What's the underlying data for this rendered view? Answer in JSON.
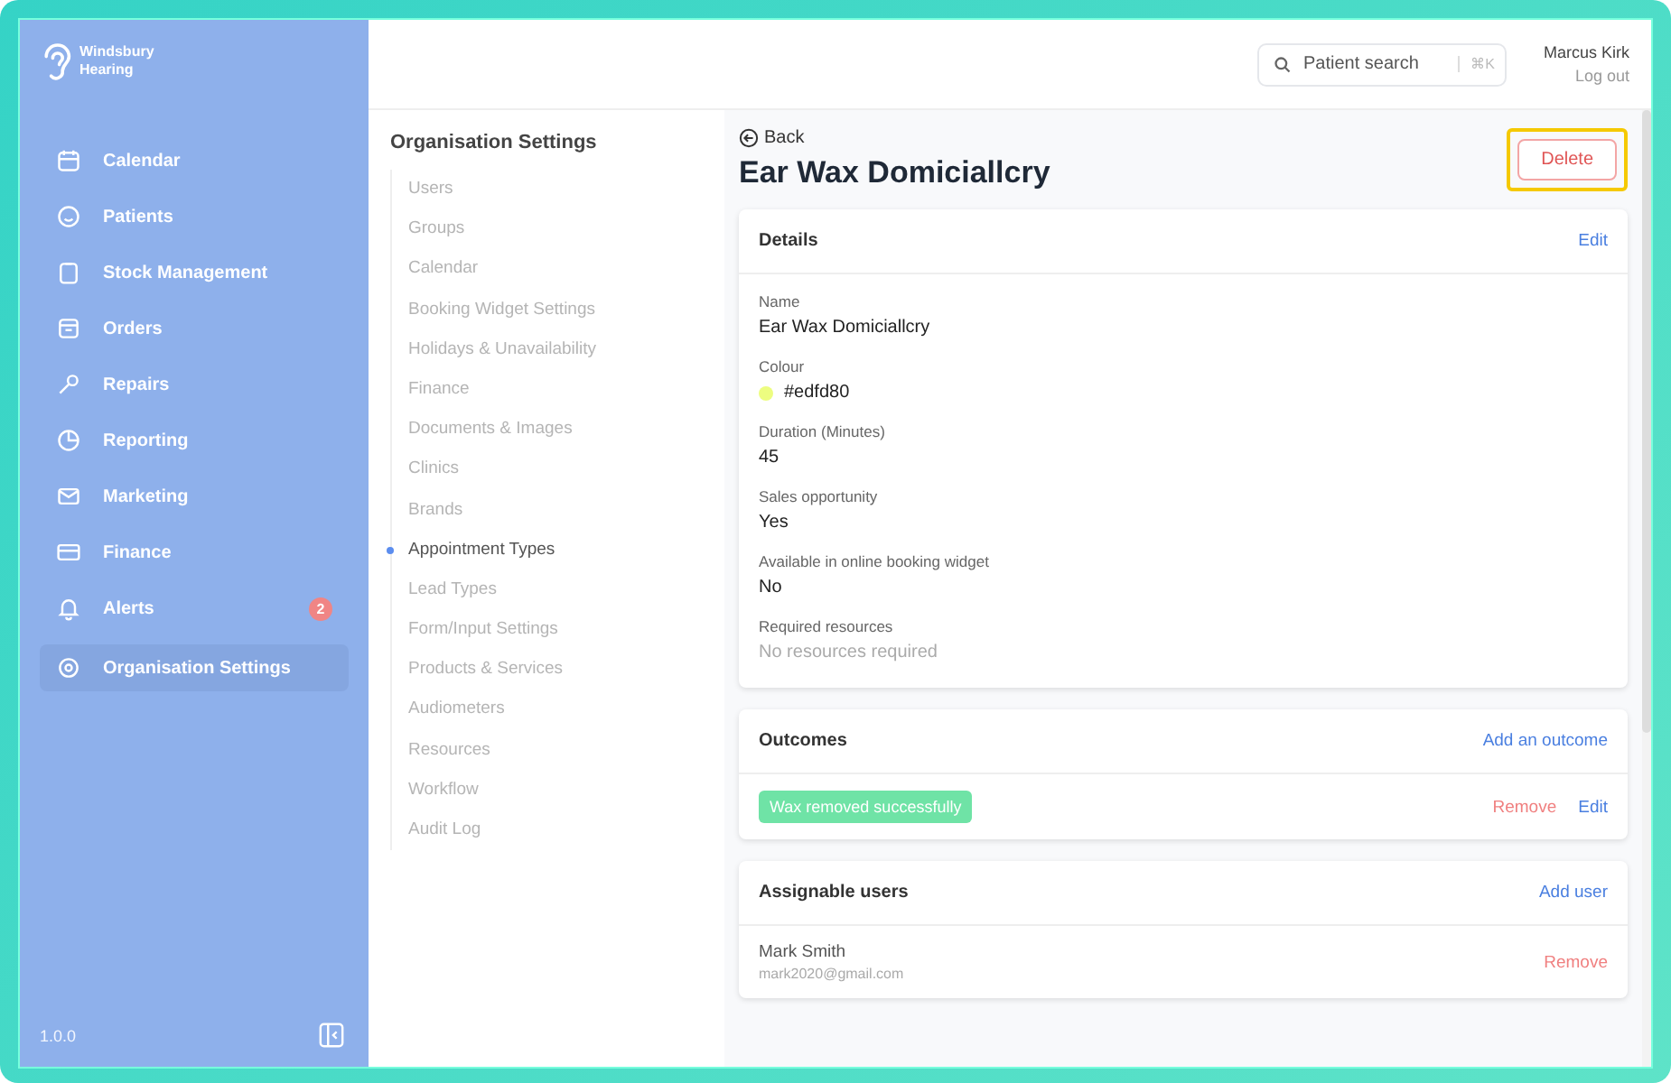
{
  "sidebar": {
    "logo": "Windsbury Hearing",
    "items": [
      {
        "label": "Calendar",
        "selected": false
      },
      {
        "label": "Patients",
        "selected": false
      },
      {
        "label": "Stock Management",
        "selected": false
      },
      {
        "label": "Orders",
        "selected": false
      },
      {
        "label": "Repairs",
        "selected": false
      },
      {
        "label": "Reporting",
        "selected": false
      },
      {
        "label": "Marketing",
        "selected": false
      },
      {
        "label": "Finance",
        "selected": false
      },
      {
        "label": "Alerts",
        "selected": false,
        "badge": "2"
      },
      {
        "label": "Organisation Settings",
        "selected": true
      }
    ],
    "version": "1.0.0"
  },
  "header": {
    "search": {
      "placeholder": "Patient search",
      "shortcut": "⌘K"
    },
    "user_name": "Marcus Kirk",
    "logout": "Log out"
  },
  "settings_nav": {
    "title": "Organisation Settings",
    "items": [
      {
        "label": "Users",
        "selected": false
      },
      {
        "label": "Groups",
        "selected": false
      },
      {
        "label": "Calendar",
        "selected": false
      },
      {
        "label": "Booking Widget Settings",
        "selected": false
      },
      {
        "label": "Holidays & Unavailability",
        "selected": false
      },
      {
        "label": "Finance",
        "selected": false
      },
      {
        "label": "Documents & Images",
        "selected": false
      },
      {
        "label": "Clinics",
        "selected": false
      },
      {
        "label": "Brands",
        "selected": false
      },
      {
        "label": "Appointment Types",
        "selected": true
      },
      {
        "label": "Lead Types",
        "selected": false
      },
      {
        "label": "Form/Input Settings",
        "selected": false
      },
      {
        "label": "Products & Services",
        "selected": false
      },
      {
        "label": "Audiometers",
        "selected": false
      },
      {
        "label": "Resources",
        "selected": false
      },
      {
        "label": "Workflow",
        "selected": false
      },
      {
        "label": "Audit Log",
        "selected": false
      }
    ]
  },
  "page": {
    "back": "Back",
    "title": "Ear Wax Domiciallcry",
    "delete_button": {
      "label": "Delete",
      "highlighted": true
    },
    "details": {
      "title": "Details",
      "edit": "Edit",
      "fields": [
        {
          "label": "Name",
          "value": "Ear Wax Domiciallcry",
          "kind": "text"
        },
        {
          "label": "Colour",
          "value": "#edfd80",
          "kind": "color",
          "color": "#edfd80"
        },
        {
          "label": "Duration (Minutes)",
          "value": "45",
          "kind": "text"
        },
        {
          "label": "Sales opportunity",
          "value": "Yes",
          "kind": "text"
        },
        {
          "label": "Available in online booking widget",
          "value": "No",
          "kind": "text"
        },
        {
          "label": "Required resources",
          "value": "No resources required",
          "kind": "muted"
        }
      ]
    },
    "outcomes": {
      "title": "Outcomes",
      "add": "Add an outcome",
      "items": [
        {
          "label": "Wax removed successfully",
          "color": "#6fe3a6",
          "remove": "Remove",
          "edit": "Edit"
        }
      ]
    },
    "assignable_users": {
      "title": "Assignable users",
      "add": "Add user",
      "users": [
        {
          "name": "Mark Smith",
          "email": "mark2020@gmail.com",
          "remove": "Remove"
        }
      ]
    }
  }
}
